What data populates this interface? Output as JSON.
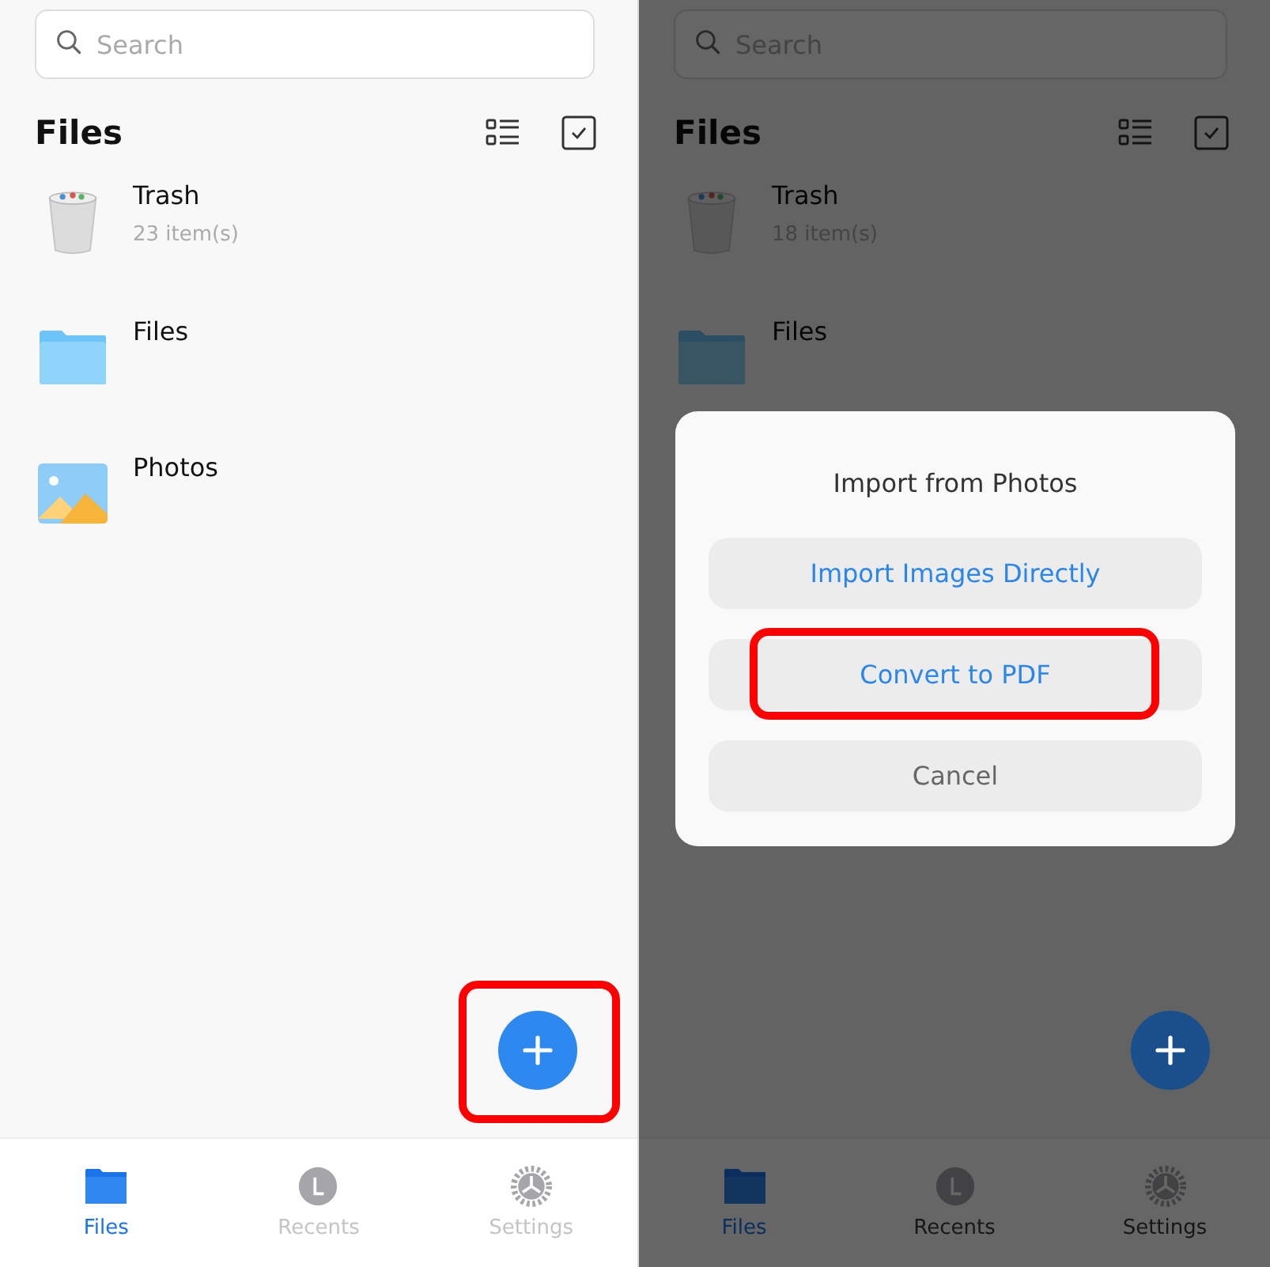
{
  "screens": [
    {
      "search": {
        "placeholder": "Search"
      },
      "title": "Files",
      "items": [
        {
          "kind": "trash",
          "name": "Trash",
          "count": "23 item(s)"
        },
        {
          "kind": "folder",
          "name": "Files"
        },
        {
          "kind": "photos",
          "name": "Photos"
        }
      ],
      "fab": {
        "highlighted": true
      },
      "tabs": [
        {
          "kind": "files",
          "label": "Files",
          "selected": true
        },
        {
          "kind": "recents",
          "label": "Recents",
          "selected": false
        },
        {
          "kind": "settings",
          "label": "Settings",
          "selected": false
        }
      ]
    },
    {
      "search": {
        "placeholder": "Search"
      },
      "title": "Files",
      "items": [
        {
          "kind": "trash",
          "name": "Trash",
          "count": "18 item(s)"
        },
        {
          "kind": "folder",
          "name": "Files"
        }
      ],
      "fab": {
        "highlighted": false
      },
      "tabs": [
        {
          "kind": "files",
          "label": "Files",
          "selected": true
        },
        {
          "kind": "recents",
          "label": "Recents",
          "selected": false
        },
        {
          "kind": "settings",
          "label": "Settings",
          "selected": false
        }
      ],
      "dialog": {
        "title": "Import from Photos",
        "buttons": [
          {
            "kind": "action",
            "label": "Import Images Directly",
            "highlighted": false
          },
          {
            "kind": "action",
            "label": "Convert to PDF",
            "highlighted": true
          },
          {
            "kind": "cancel",
            "label": "Cancel",
            "highlighted": false
          }
        ]
      }
    }
  ]
}
